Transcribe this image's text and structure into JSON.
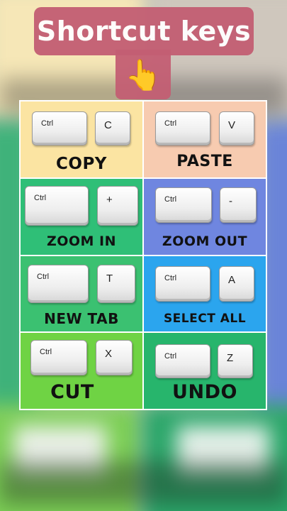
{
  "title": "Shortcut keys",
  "pointer_emoji": "👆",
  "colors": {
    "title_bg": "#c35e73",
    "copy": "#fbe4a2",
    "paste": "#f7cbb0",
    "zoom_in": "#2fbf77",
    "zoom_out": "#6f86e0",
    "new_tab": "#3bc171",
    "select_all": "#2ba5ee",
    "cut": "#6fd344",
    "undo": "#27b56c"
  },
  "shortcuts": [
    {
      "modifier": "Ctrl",
      "key": "C",
      "label": "COPY"
    },
    {
      "modifier": "Ctrl",
      "key": "V",
      "label": "PASTE"
    },
    {
      "modifier": "Ctrl",
      "key": "+",
      "label": "ZOOM IN"
    },
    {
      "modifier": "Ctrl",
      "key": "-",
      "label": "ZOOM OUT"
    },
    {
      "modifier": "Ctrl",
      "key": "T",
      "label": "NEW TAB"
    },
    {
      "modifier": "Ctrl",
      "key": "A",
      "label": "SELECT ALL"
    },
    {
      "modifier": "Ctrl",
      "key": "X",
      "label": "CUT"
    },
    {
      "modifier": "Ctrl",
      "key": "Z",
      "label": "UNDO"
    }
  ]
}
